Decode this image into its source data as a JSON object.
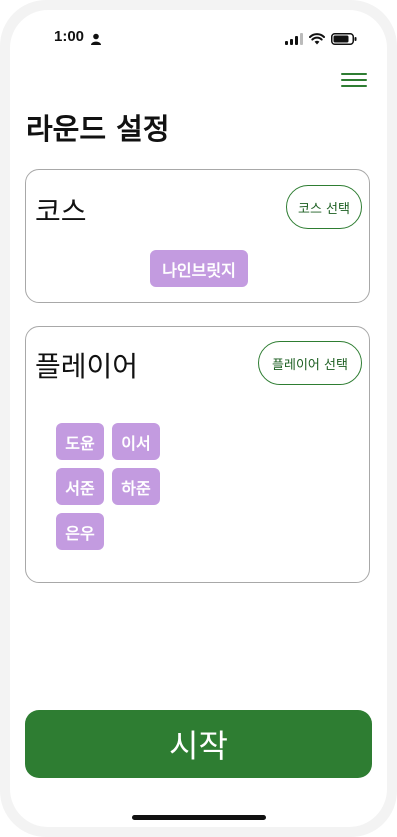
{
  "status_bar": {
    "time": "1:00"
  },
  "page": {
    "title": "라운드 설정"
  },
  "course_card": {
    "title": "코스",
    "select_button": "코스 선택",
    "selected_course": "나인브릿지"
  },
  "player_card": {
    "title": "플레이어",
    "select_button": "플레이어 선택",
    "players": [
      "도윤",
      "이서",
      "서준",
      "하준",
      "은우"
    ]
  },
  "start_button": "시작",
  "colors": {
    "accent": "#2e7d32",
    "chip": "#c39be0"
  },
  "icons": [
    "person-icon",
    "cellular-signal-icon",
    "wifi-icon",
    "battery-icon",
    "hamburger-menu-icon"
  ]
}
